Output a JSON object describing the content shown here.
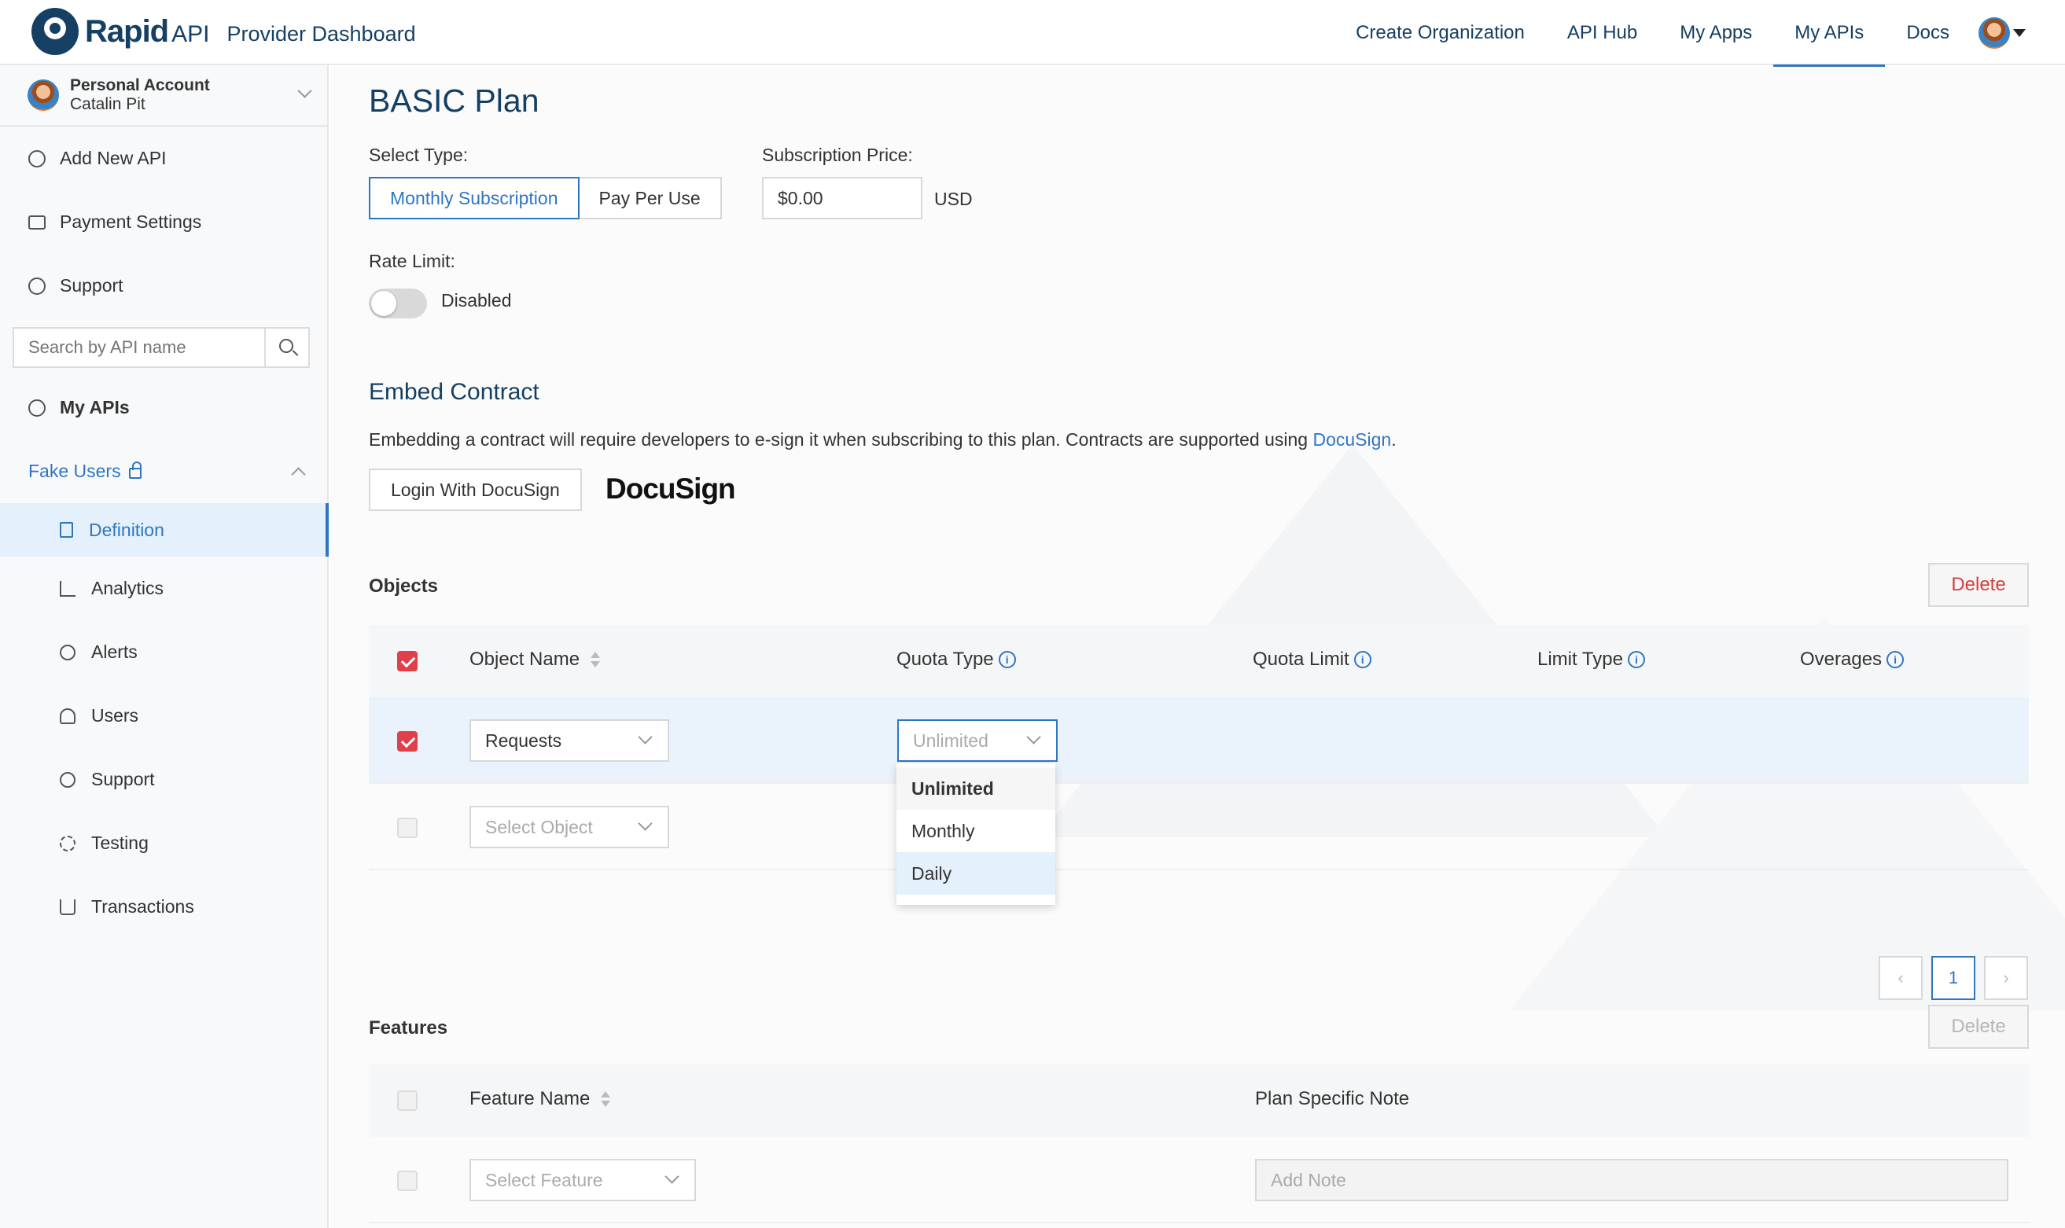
{
  "header": {
    "logo_text": "Rapid",
    "logo_api": "API",
    "subtitle": "Provider Dashboard",
    "nav": [
      "Create Organization",
      "API Hub",
      "My Apps",
      "My APIs",
      "Docs"
    ],
    "active_nav": "My APIs"
  },
  "sidebar": {
    "account_type": "Personal Account",
    "account_name": "Catalin Pit",
    "top_items": [
      "Add New API",
      "Payment Settings",
      "Support"
    ],
    "search_placeholder": "Search by API name",
    "my_apis": "My APIs",
    "api_name": "Fake Users",
    "sub_items": [
      "Definition",
      "Analytics",
      "Alerts",
      "Users",
      "Support",
      "Testing",
      "Transactions"
    ],
    "active_sub": "Definition"
  },
  "plan": {
    "title": "BASIC Plan",
    "select_type_label": "Select Type:",
    "types": [
      "Monthly Subscription",
      "Pay Per Use"
    ],
    "selected_type": "Monthly Subscription",
    "price_label": "Subscription Price:",
    "price_value": "$0.00",
    "currency": "USD",
    "rate_limit_label": "Rate Limit:",
    "rate_limit_state": "Disabled"
  },
  "contract": {
    "title": "Embed Contract",
    "text": "Embedding a contract will require developers to e-sign it when subscribing to this plan. Contracts are supported using ",
    "link": "DocuSign",
    "text_end": ".",
    "login_button": "Login With DocuSign",
    "brand": "DocuSign"
  },
  "objects": {
    "title": "Objects",
    "delete_label": "Delete",
    "columns": [
      "Object Name",
      "Quota Type",
      "Quota Limit",
      "Limit Type",
      "Overages"
    ],
    "row1_object": "Requests",
    "row1_quota": "Unlimited",
    "row2_placeholder": "Select Object",
    "dropdown_options": [
      "Unlimited",
      "Monthly",
      "Daily"
    ],
    "page": "1"
  },
  "features": {
    "title": "Features",
    "delete_label": "Delete",
    "columns": [
      "Feature Name",
      "Plan Specific Note"
    ],
    "select_placeholder": "Select Feature",
    "note_placeholder": "Add Note"
  },
  "colors": {
    "brand": "#153f63",
    "accent": "#2f76c2",
    "danger": "#d93c3c"
  }
}
